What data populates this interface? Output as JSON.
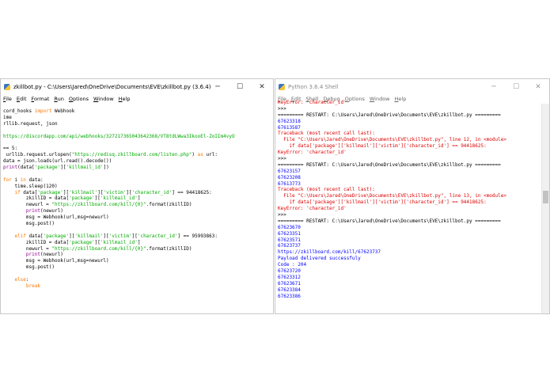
{
  "editor": {
    "title": "zkillbot.py - C:\\Users\\Jared\\OneDrive\\Documents\\EVE\\zkillbot.py (3.6.4)",
    "menu": [
      "File",
      "Edit",
      "Format",
      "Run",
      "Options",
      "Window",
      "Help"
    ],
    "code_lines": [
      [
        {
          "t": "cord_hooks "
        },
        {
          "t": "import",
          "c": "kw"
        },
        {
          "t": " Webhook"
        }
      ],
      [
        {
          "t": "ime"
        }
      ],
      [
        {
          "t": "rllib.request, json"
        }
      ],
      [],
      [
        {
          "t": "https://discordapp.com/api/webhooks/327217365043642368/VT8tdLWwa3IkooEl-ZoIIm4vyO",
          "c": "str"
        }
      ],
      [],
      [
        {
          "t": "== 5:"
        }
      ],
      [
        {
          "t": " urllib.request.urlopen("
        },
        {
          "t": "\"https://redisq.zkillboard.com/listen.php\"",
          "c": "str"
        },
        {
          "t": ") "
        },
        {
          "t": "as",
          "c": "kw"
        },
        {
          "t": " url:"
        }
      ],
      [
        {
          "t": "data = json.loads(url.read().decode())"
        }
      ],
      [
        {
          "t": "print",
          "c": "bi"
        },
        {
          "t": "(data["
        },
        {
          "t": "'package'",
          "c": "str"
        },
        {
          "t": "]["
        },
        {
          "t": "'killmail_id'",
          "c": "str"
        },
        {
          "t": "])"
        }
      ],
      [],
      [
        {
          "t": "for",
          "c": "kw"
        },
        {
          "t": " i "
        },
        {
          "t": "in",
          "c": "kw"
        },
        {
          "t": " data:"
        }
      ],
      [
        {
          "t": "    time.sleep(120)"
        }
      ],
      [
        {
          "t": "    "
        },
        {
          "t": "if",
          "c": "kw"
        },
        {
          "t": " data["
        },
        {
          "t": "'package'",
          "c": "str"
        },
        {
          "t": "]["
        },
        {
          "t": "'killmail'",
          "c": "str"
        },
        {
          "t": "]["
        },
        {
          "t": "'victim'",
          "c": "str"
        },
        {
          "t": "]["
        },
        {
          "t": "'character_id'",
          "c": "str"
        },
        {
          "t": "] == 94418625:"
        }
      ],
      [
        {
          "t": "        zkillID = data["
        },
        {
          "t": "'package'",
          "c": "str"
        },
        {
          "t": "]["
        },
        {
          "t": "'killmail_id'",
          "c": "str"
        },
        {
          "t": "]"
        }
      ],
      [
        {
          "t": "        newurl = "
        },
        {
          "t": "\"https://zkillboard.com/kill/{0}\"",
          "c": "str"
        },
        {
          "t": ".format(zkillID)"
        }
      ],
      [
        {
          "t": "        "
        },
        {
          "t": "print",
          "c": "bi"
        },
        {
          "t": "(newurl)"
        }
      ],
      [
        {
          "t": "        msg = Webhook(url,msg=newurl)"
        }
      ],
      [
        {
          "t": "        msg.post()"
        }
      ],
      [],
      [
        {
          "t": "    "
        },
        {
          "t": "elif",
          "c": "kw"
        },
        {
          "t": " data["
        },
        {
          "t": "'package'",
          "c": "str"
        },
        {
          "t": "]["
        },
        {
          "t": "'killmail'",
          "c": "str"
        },
        {
          "t": "]["
        },
        {
          "t": "'victim'",
          "c": "str"
        },
        {
          "t": "]["
        },
        {
          "t": "'character_id'",
          "c": "str"
        },
        {
          "t": "] == 95993863:"
        }
      ],
      [
        {
          "t": "        zkillID = data["
        },
        {
          "t": "'package'",
          "c": "str"
        },
        {
          "t": "]["
        },
        {
          "t": "'killmail_id'",
          "c": "str"
        },
        {
          "t": "]"
        }
      ],
      [
        {
          "t": "        newurl = "
        },
        {
          "t": "\"https://zkillboard.com/kill/{0}\"",
          "c": "str"
        },
        {
          "t": ".format(zkillID)"
        }
      ],
      [
        {
          "t": "        "
        },
        {
          "t": "print",
          "c": "bi"
        },
        {
          "t": "(newurl)"
        }
      ],
      [
        {
          "t": "        msg = Webhook(url,msg=newurl)"
        }
      ],
      [
        {
          "t": "        msg.post()"
        }
      ],
      [],
      [
        {
          "t": "    "
        },
        {
          "t": "else",
          "c": "kw"
        },
        {
          "t": ":"
        }
      ],
      [
        {
          "t": "        "
        },
        {
          "t": "break",
          "c": "kw"
        }
      ]
    ]
  },
  "shell": {
    "title": "Python 3.6.4 Shell",
    "menu": [
      "File",
      "Edit",
      "Shell",
      "Debug",
      "Options",
      "Window",
      "Help"
    ],
    "lines": [
      {
        "t": "KeyError: 'character_id'",
        "c": "red"
      },
      {
        "t": ">>> "
      },
      {
        "t": "========= RESTART: C:\\Users\\Jared\\OneDrive\\Documents\\EVE\\zkillbot.py ========="
      },
      {
        "t": "67623318",
        "c": "blue"
      },
      {
        "t": "67613587",
        "c": "blue"
      },
      {
        "t": "Traceback (most recent call last):",
        "c": "red"
      },
      {
        "t": "  File \"C:\\Users\\Jared\\OneDrive\\Documents\\EVE\\zkillbot.py\", line 12, in <module>",
        "c": "red"
      },
      {
        "t": "    if data['package']['killmail']['victim']['character_id'] == 94418625:",
        "c": "red"
      },
      {
        "t": "KeyError: 'character_id'",
        "c": "red"
      },
      {
        "t": ">>> "
      },
      {
        "t": "========= RESTART: C:\\Users\\Jared\\OneDrive\\Documents\\EVE\\zkillbot.py ========="
      },
      {
        "t": "67623157",
        "c": "blue"
      },
      {
        "t": "67623208",
        "c": "blue"
      },
      {
        "t": "67613773",
        "c": "blue"
      },
      {
        "t": "Traceback (most recent call last):",
        "c": "red"
      },
      {
        "t": "  File \"C:\\Users\\Jared\\OneDrive\\Documents\\EVE\\zkillbot.py\", line 13, in <module>",
        "c": "red"
      },
      {
        "t": "    if data['package']['killmail']['victim']['character_id'] == 94418625:",
        "c": "red"
      },
      {
        "t": "KeyError: 'character_id'",
        "c": "red"
      },
      {
        "t": ">>> "
      },
      {
        "t": "========= RESTART: C:\\Users\\Jared\\OneDrive\\Documents\\EVE\\zkillbot.py ========="
      },
      {
        "t": "67623670",
        "c": "blue"
      },
      {
        "t": "67623351",
        "c": "blue"
      },
      {
        "t": "67623571",
        "c": "blue"
      },
      {
        "t": "67623737",
        "c": "blue"
      },
      {
        "t": "https://zkillboard.com/kill/67623737",
        "c": "blue"
      },
      {
        "t": "Payload delivered successfuly",
        "c": "blue"
      },
      {
        "t": "Code : 204",
        "c": "blue"
      },
      {
        "t": "67623720",
        "c": "blue"
      },
      {
        "t": "67623312",
        "c": "blue"
      },
      {
        "t": "67623671",
        "c": "blue"
      },
      {
        "t": "67623384",
        "c": "blue"
      },
      {
        "t": "67623386",
        "c": "blue"
      }
    ]
  },
  "window_buttons": {
    "minimize": "─",
    "maximize": "☐",
    "close": "✕"
  }
}
